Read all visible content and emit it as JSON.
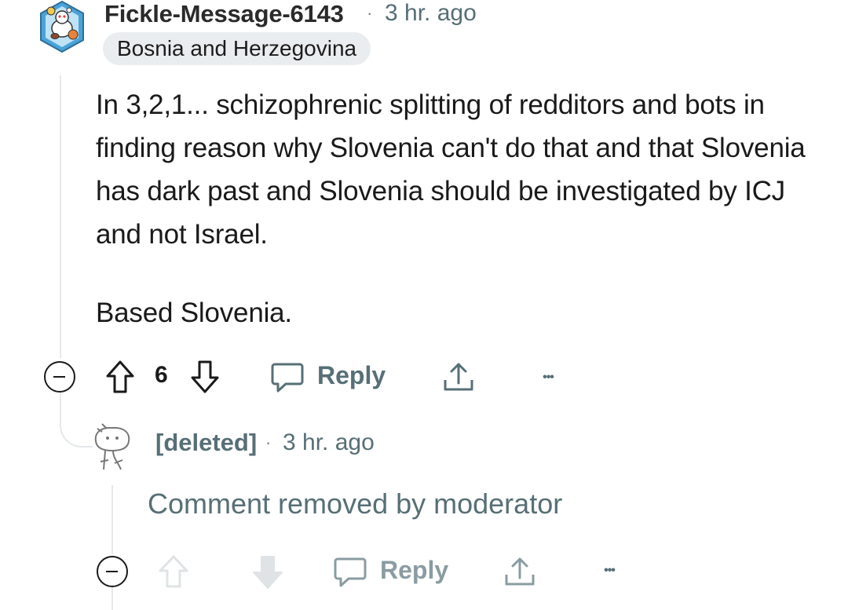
{
  "comment": {
    "username": "Fickle-Message-6143",
    "separator": "·",
    "timestamp": "3 hr. ago",
    "flair": "Bosnia and Herzegovina",
    "body": [
      "In 3,2,1... schizophrenic splitting of redditors and bots in finding reason why Slovenia can't do that and that Slovenia has dark past and Slovenia should be investigated by ICJ and not Israel.",
      "Based Slovenia."
    ],
    "actions": {
      "vote_count": "6",
      "reply_label": "Reply",
      "more_label": "•••"
    }
  },
  "reply": {
    "username": "[deleted]",
    "separator": "·",
    "timestamp": "3 hr. ago",
    "body": "Comment removed by moderator",
    "actions": {
      "reply_label": "Reply",
      "more_label": "•••"
    }
  },
  "icons": {
    "avatar": "snoo-avatar-icon",
    "upvote": "upvote-arrow-icon",
    "downvote": "downvote-arrow-icon",
    "reply": "speech-bubble-icon",
    "share": "share-icon",
    "more": "more-options-icon",
    "collapse": "collapse-minus-icon",
    "deleted_avatar": "deleted-snoo-icon"
  },
  "colors": {
    "meta_gray": "#576f76",
    "flair_bg": "#eaedef",
    "thread_line": "#e5e8ea",
    "text": "#1a1a1b"
  }
}
